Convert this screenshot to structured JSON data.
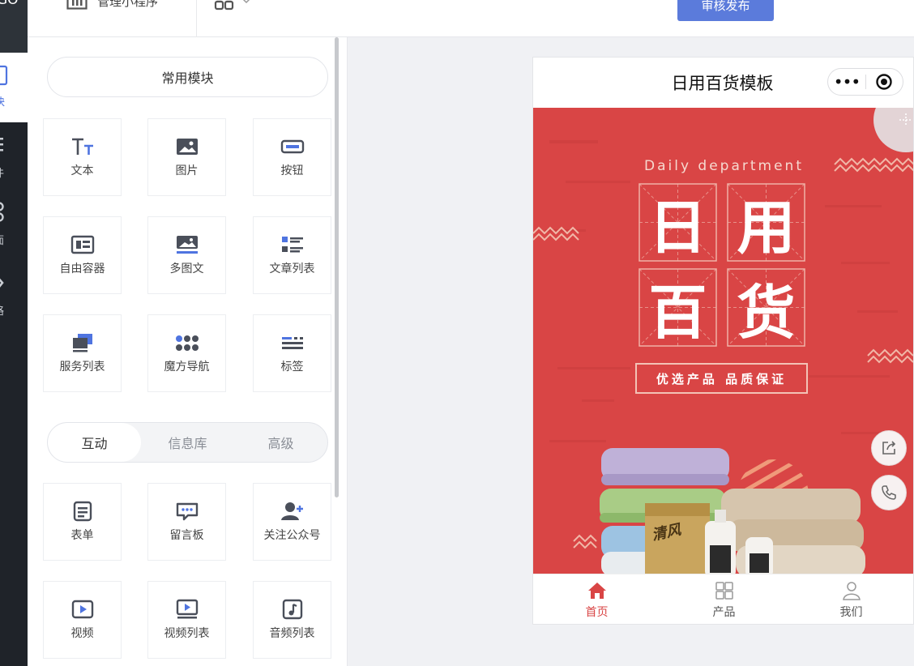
{
  "rail": {
    "brand_fragment": "GO",
    "items": [
      {
        "label": "块",
        "active": true
      },
      {
        "label": "件"
      },
      {
        "label": "面"
      },
      {
        "label": "咯"
      }
    ]
  },
  "topbar": {
    "manage_label": "管理小程序",
    "publish_label": "审核发布"
  },
  "panel": {
    "section_title": "常用模块",
    "common_modules": [
      {
        "label": "文本",
        "icon": "text-icon"
      },
      {
        "label": "图片",
        "icon": "image-icon"
      },
      {
        "label": "按钮",
        "icon": "button-icon"
      },
      {
        "label": "自由容器",
        "icon": "container-icon"
      },
      {
        "label": "多图文",
        "icon": "multi-image-text-icon"
      },
      {
        "label": "文章列表",
        "icon": "article-list-icon"
      },
      {
        "label": "服务列表",
        "icon": "service-list-icon"
      },
      {
        "label": "魔方导航",
        "icon": "cube-nav-icon"
      },
      {
        "label": "标签",
        "icon": "tag-icon"
      }
    ],
    "tabs": [
      {
        "label": "互动",
        "active": true
      },
      {
        "label": "信息库"
      },
      {
        "label": "高级"
      }
    ],
    "interact_modules": [
      {
        "label": "表单",
        "icon": "form-icon"
      },
      {
        "label": "留言板",
        "icon": "message-board-icon"
      },
      {
        "label": "关注公众号",
        "icon": "follow-account-icon"
      },
      {
        "label": "视频",
        "icon": "video-icon"
      },
      {
        "label": "视频列表",
        "icon": "video-list-icon"
      },
      {
        "label": "音频列表",
        "icon": "audio-list-icon"
      }
    ]
  },
  "phone": {
    "title": "日用百货模板",
    "capsule_dots": "•••",
    "banner": {
      "subtitle": "Daily department",
      "char_1": "日",
      "char_2": "用",
      "char_3": "百",
      "char_4": "货",
      "slogan": "优选产品 品质保证",
      "product_text": "清风",
      "color": "#d94545"
    },
    "nav": [
      {
        "label": "首页",
        "icon": "home-icon",
        "active": true
      },
      {
        "label": "产品",
        "icon": "grid-icon"
      },
      {
        "label": "我们",
        "icon": "user-icon"
      }
    ]
  },
  "colors": {
    "accent": "#5b7bdb",
    "brand_red": "#d94545",
    "rail": "#1f2329"
  }
}
